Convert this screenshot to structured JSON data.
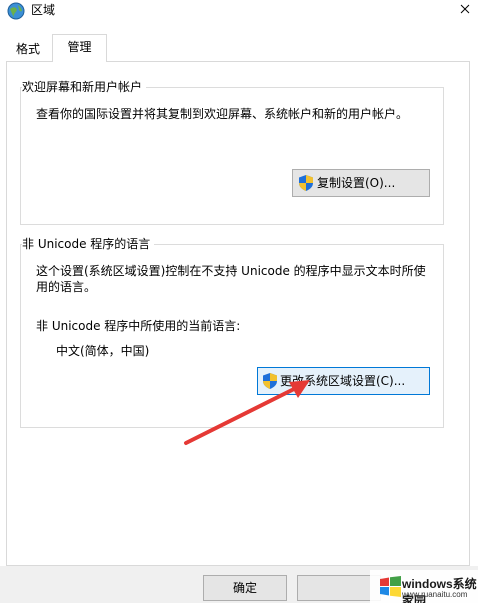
{
  "window": {
    "title": "区域",
    "icon": "globe-icon",
    "close_icon": "close-icon"
  },
  "tabs": [
    {
      "label": "格式",
      "selected": false
    },
    {
      "label": "管理",
      "selected": true
    }
  ],
  "welcome_group": {
    "title": "欢迎屏幕和新用户帐户",
    "description": "查看你的国际设置并将其复制到欢迎屏幕、系统帐户和新的用户帐户。",
    "copy_button": "复制设置(O)..."
  },
  "unicode_group": {
    "title": "非 Unicode 程序的语言",
    "description": "这个设置(系统区域设置)控制在不支持 Unicode 的程序中显示文本时所使用的语言。",
    "current_label": "非 Unicode 程序中所使用的当前语言:",
    "current_value": "中文(简体，中国)",
    "change_button": "更改系统区域设置(C)..."
  },
  "footer": {
    "ok_button": "确定"
  },
  "watermark": {
    "brand": "windows系统家园",
    "url": "www.ruanaitu.com"
  },
  "colors": {
    "annotation_arrow": "#e53935",
    "shield_blue": "#1e6fd9",
    "shield_yellow": "#f2c12e"
  }
}
